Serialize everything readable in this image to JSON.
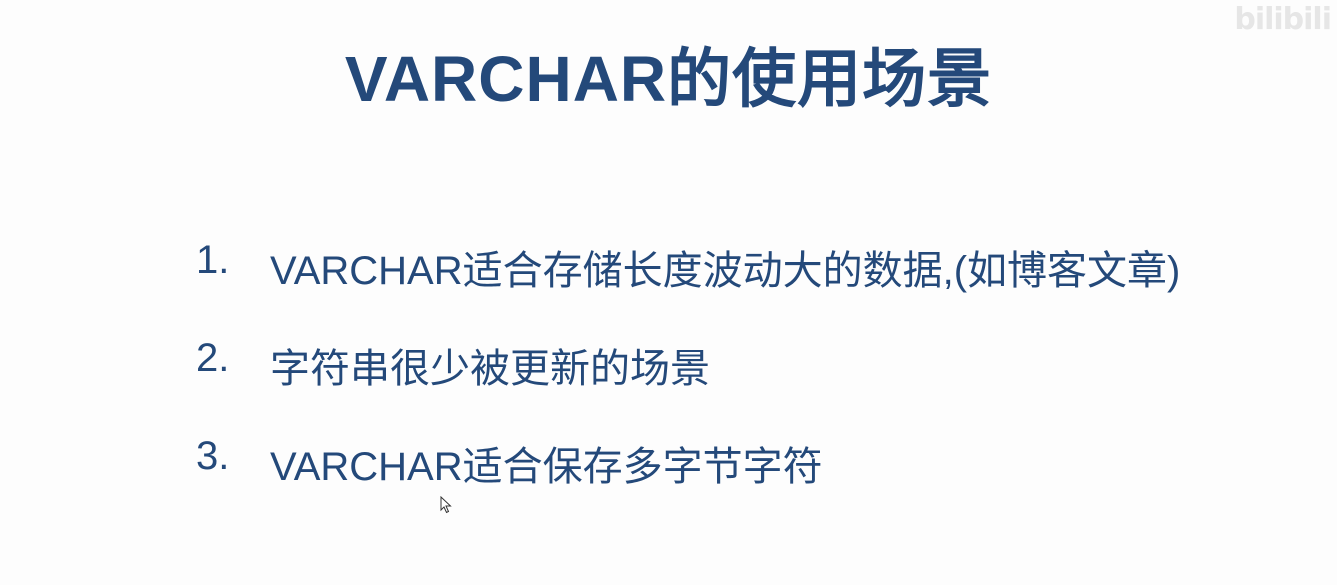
{
  "slide": {
    "title": "VARCHAR的使用场景",
    "items": [
      {
        "num": "1.",
        "text": "VARCHAR适合存储长度波动大的数据,(如博客文章)"
      },
      {
        "num": "2.",
        "text": "字符串很少被更新的场景"
      },
      {
        "num": "3.",
        "text": "VARCHAR适合保存多字节字符"
      }
    ],
    "watermark": "bilibili"
  },
  "colors": {
    "text": "#24497a",
    "background": "#fdfdfd"
  },
  "icons": {
    "cursor": "mouse-pointer-icon"
  }
}
